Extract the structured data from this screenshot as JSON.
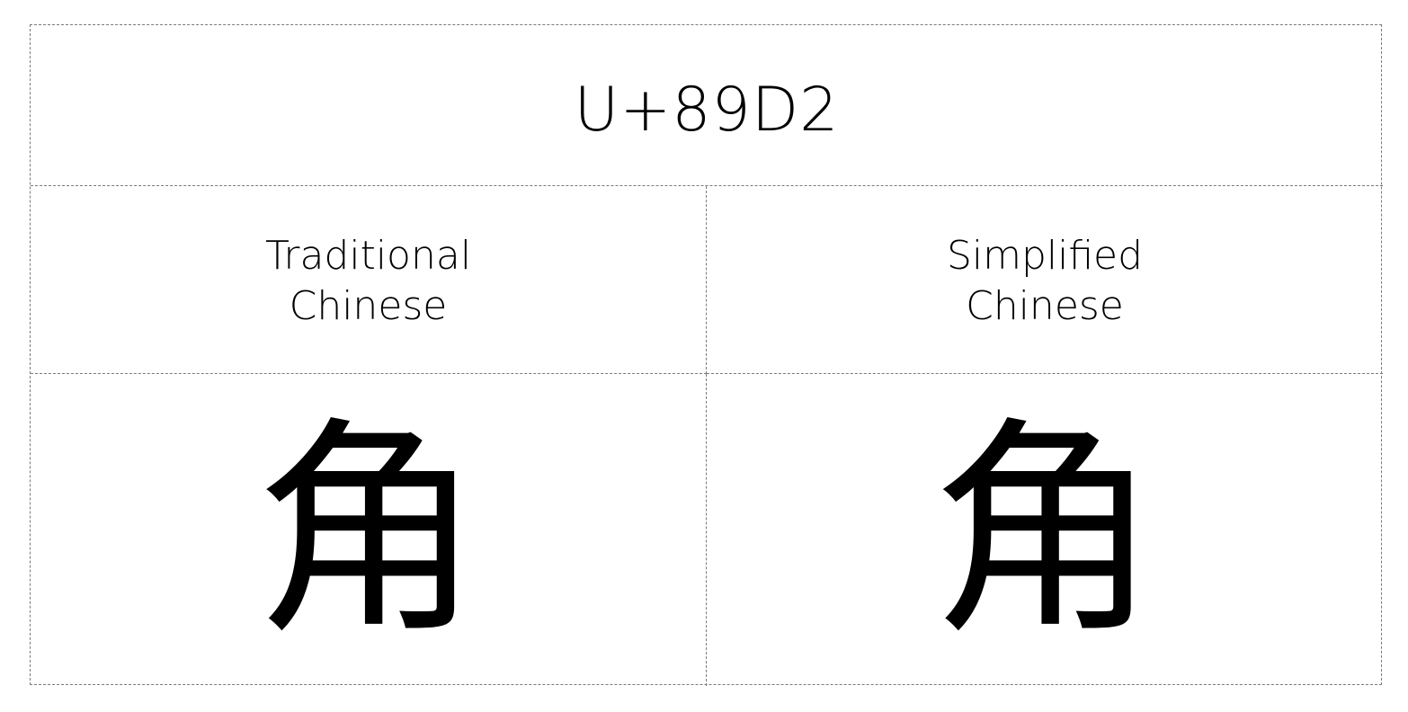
{
  "title": "U+89D2",
  "columns": [
    {
      "label_line1": "Traditional",
      "label_line2": "Chinese",
      "glyph": "角"
    },
    {
      "label_line1": "Simplified",
      "label_line2": "Chinese",
      "glyph": "角"
    }
  ]
}
